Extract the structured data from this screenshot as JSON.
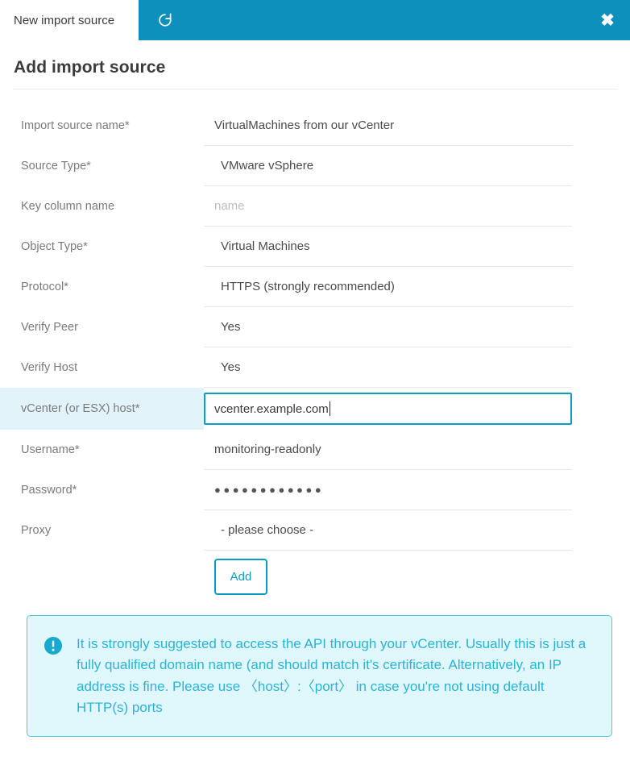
{
  "titlebar": {
    "tab_label": "New import source",
    "refresh_icon": "refresh-icon",
    "close_label": "✖",
    "accent_color": "#0d90bc"
  },
  "page": {
    "title": "Add import source"
  },
  "form": {
    "rows": [
      {
        "label": "Import source name*",
        "value": "VirtualMachines from our vCenter",
        "kind": "text"
      },
      {
        "label": "Source Type*",
        "value": "VMware vSphere",
        "kind": "select"
      },
      {
        "label": "Key column name",
        "value": "",
        "placeholder": "name",
        "kind": "text"
      },
      {
        "label": "Object Type*",
        "value": "Virtual Machines",
        "kind": "select"
      },
      {
        "label": "Protocol*",
        "value": "HTTPS (strongly recommended)",
        "kind": "select"
      },
      {
        "label": "Verify Peer",
        "value": "Yes",
        "kind": "select"
      },
      {
        "label": "Verify Host",
        "value": "Yes",
        "kind": "select"
      },
      {
        "label": "vCenter (or ESX) host*",
        "value": "vcenter.example.com",
        "kind": "text-focused"
      },
      {
        "label": "Username*",
        "value": "monitoring-readonly",
        "kind": "text"
      },
      {
        "label": "Password*",
        "value": "●●●●●●●●●●●●",
        "kind": "password"
      },
      {
        "label": "Proxy",
        "value": "- please choose -",
        "kind": "select"
      }
    ],
    "submit_label": "Add"
  },
  "alert": {
    "icon": "exclamation-circle-icon",
    "text": "It is strongly suggested to access the API through your vCenter. Usually this is just a fully qualified domain name (and should match it's certificate. Alternatively, an IP address is fine. Please use 〈host〉:〈port〉 in case you're not using default HTTP(s) ports",
    "color": "#27b5d8",
    "background": "#e0f7fb"
  }
}
